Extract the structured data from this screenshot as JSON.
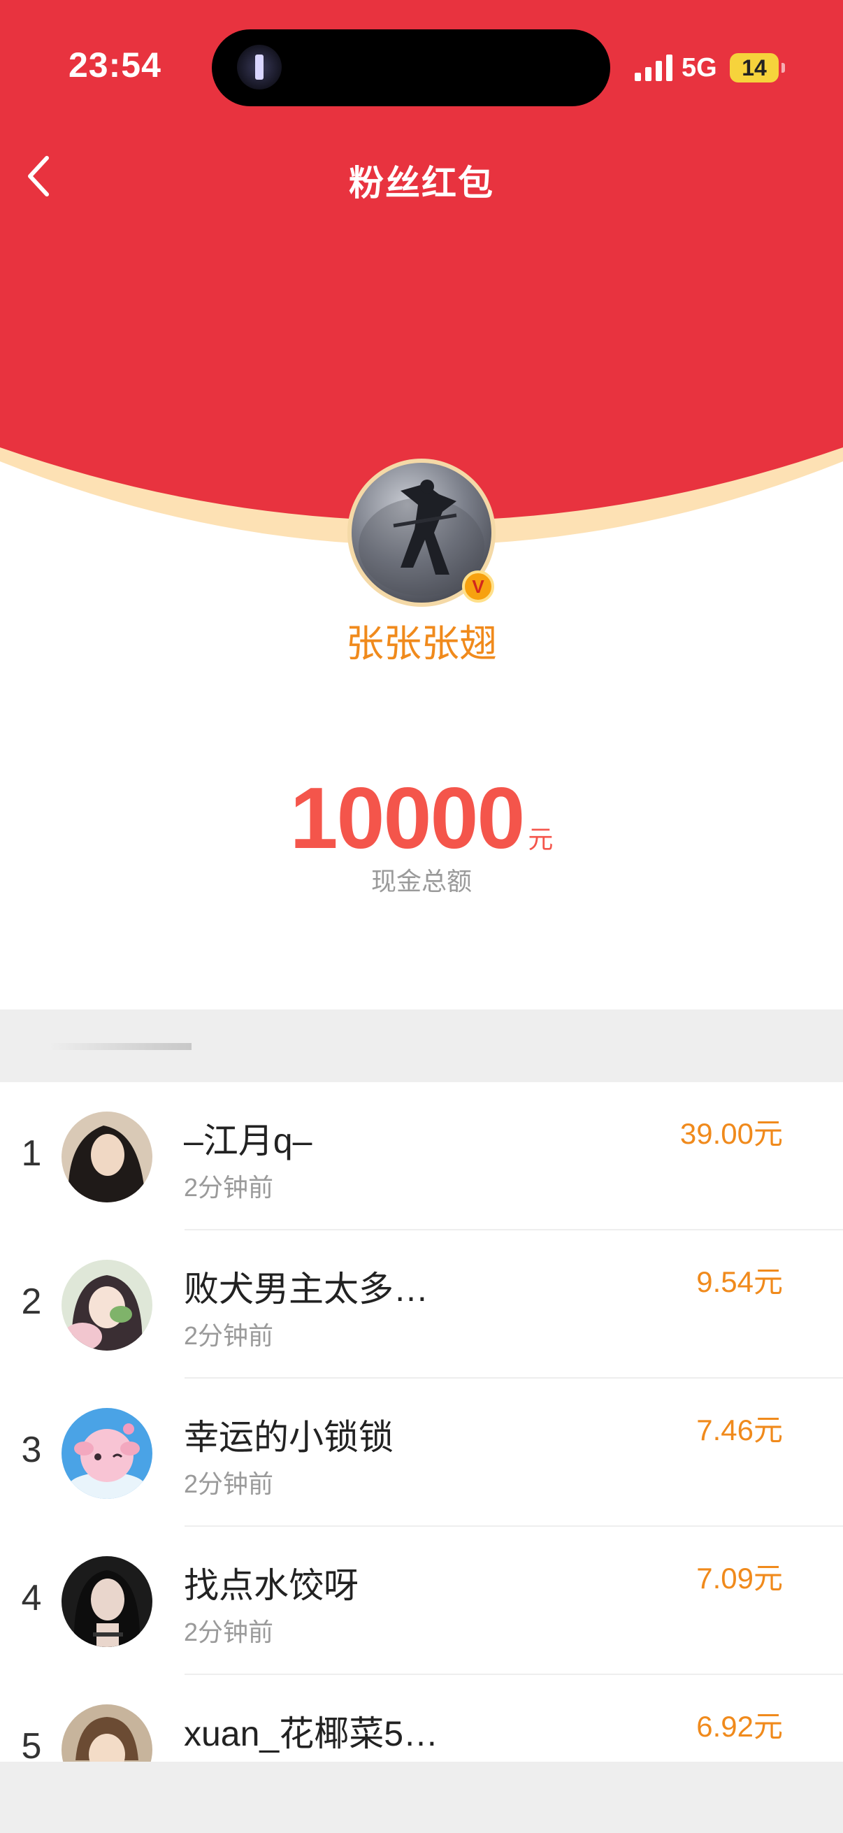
{
  "status_bar": {
    "time": "23:54",
    "network": "5G",
    "battery": "14"
  },
  "nav": {
    "title": "粉丝红包"
  },
  "creator": {
    "name": "张张张翅",
    "badge": "V"
  },
  "total": {
    "amount": "10000",
    "unit": "元",
    "caption": "现金总额"
  },
  "claims": [
    {
      "rank": "1",
      "name": "–江月q–",
      "time": "2分钟前",
      "amount": "39.00元"
    },
    {
      "rank": "2",
      "name": "败犬男主太多…",
      "time": "2分钟前",
      "amount": "9.54元"
    },
    {
      "rank": "3",
      "name": "幸运的小锁锁",
      "time": "2分钟前",
      "amount": "7.46元"
    },
    {
      "rank": "4",
      "name": "找点水饺呀",
      "time": "2分钟前",
      "amount": "7.09元"
    },
    {
      "rank": "5",
      "name": "xuan_花椰菜5…",
      "time": "",
      "amount": "6.92元"
    }
  ],
  "colors": {
    "header_red": "#e8333f",
    "curve_peach": "#fde1b4",
    "amount_red": "#f4554b",
    "accent_orange": "#f08a1c"
  }
}
